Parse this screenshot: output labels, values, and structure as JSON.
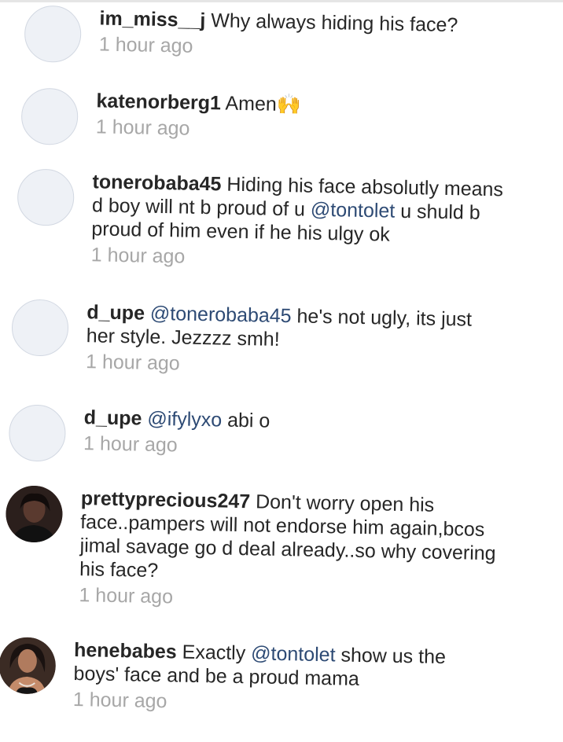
{
  "comments": [
    {
      "username": "im_miss__j",
      "segments": [
        {
          "text": " Why always hiding his face?",
          "mention": false
        }
      ],
      "time": "1 hour ago",
      "has_photo": false
    },
    {
      "username": "katenorberg1",
      "segments": [
        {
          "text": " Amen🙌",
          "mention": false
        }
      ],
      "time": "1 hour ago",
      "has_photo": false
    },
    {
      "username": "tonerobaba45",
      "segments": [
        {
          "text": " Hiding his face absolutly means d boy will nt b proud of u ",
          "mention": false
        },
        {
          "text": "@tontolet",
          "mention": true
        },
        {
          "text": " u shuld b proud of him even if he his ulgy ok",
          "mention": false
        }
      ],
      "time": "1 hour ago",
      "has_photo": false
    },
    {
      "username": "d_upe",
      "segments": [
        {
          "text": " ",
          "mention": false
        },
        {
          "text": "@tonerobaba45",
          "mention": true
        },
        {
          "text": " he's not ugly, its just her style. Jezzzz smh!",
          "mention": false
        }
      ],
      "time": "1 hour ago",
      "has_photo": false
    },
    {
      "username": "d_upe",
      "segments": [
        {
          "text": " ",
          "mention": false
        },
        {
          "text": "@ifylyxo",
          "mention": true
        },
        {
          "text": " abi o",
          "mention": false
        }
      ],
      "time": "1 hour ago",
      "has_photo": false
    },
    {
      "username": "prettyprecious247",
      "segments": [
        {
          "text": " Don't worry open his face..pampers will not endorse him again,bcos jimal savage go d deal already..so why covering his face?",
          "mention": false
        }
      ],
      "time": "1 hour ago",
      "has_photo": true
    },
    {
      "username": "henebabes",
      "segments": [
        {
          "text": " Exactly ",
          "mention": false
        },
        {
          "text": "@tontolet",
          "mention": true
        },
        {
          "text": " show us the boys' face and be a proud mama",
          "mention": false
        }
      ],
      "time": "1 hour ago",
      "has_photo": true
    }
  ]
}
